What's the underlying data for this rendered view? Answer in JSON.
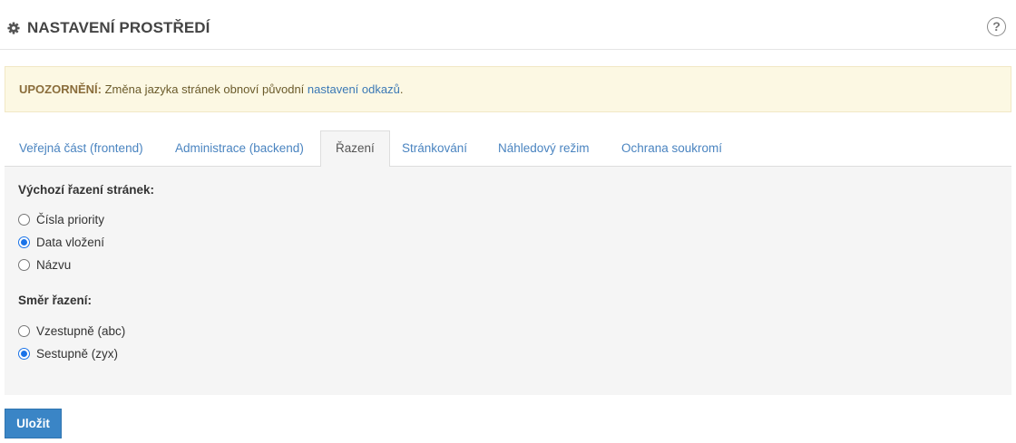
{
  "header": {
    "title": "NASTAVENÍ PROSTŘEDÍ",
    "help_glyph": "?",
    "icons": {
      "settings": "gear-icon",
      "help": "help-circle-icon"
    }
  },
  "alert": {
    "strong": "UPOZORNĚNÍ:",
    "text": " Změna jazyka stránek obnoví původní ",
    "link": "nastavení odkazů",
    "suffix": "."
  },
  "tabs": [
    {
      "label": "Veřejná část (frontend)",
      "active": false
    },
    {
      "label": "Administrace (backend)",
      "active": false
    },
    {
      "label": "Řazení",
      "active": true
    },
    {
      "label": "Stránkování",
      "active": false
    },
    {
      "label": "Náhledový režim",
      "active": false
    },
    {
      "label": "Ochrana soukromí",
      "active": false
    }
  ],
  "sorting": {
    "default_label": "Výchozí řazení stránek:",
    "default_options": [
      {
        "label": "Čísla priority",
        "checked": false
      },
      {
        "label": "Data vložení",
        "checked": true
      },
      {
        "label": "Názvu",
        "checked": false
      }
    ],
    "direction_label": "Směr řazení:",
    "direction_options": [
      {
        "label": "Vzestupně (abc)",
        "checked": false
      },
      {
        "label": "Sestupně (zyx)",
        "checked": true
      }
    ]
  },
  "save_label": "Uložit",
  "colors": {
    "accent": "#3a85c6",
    "link": "#4a84c0",
    "alert_bg": "#fcf8e3",
    "radio_checked": "#1a73e8"
  }
}
